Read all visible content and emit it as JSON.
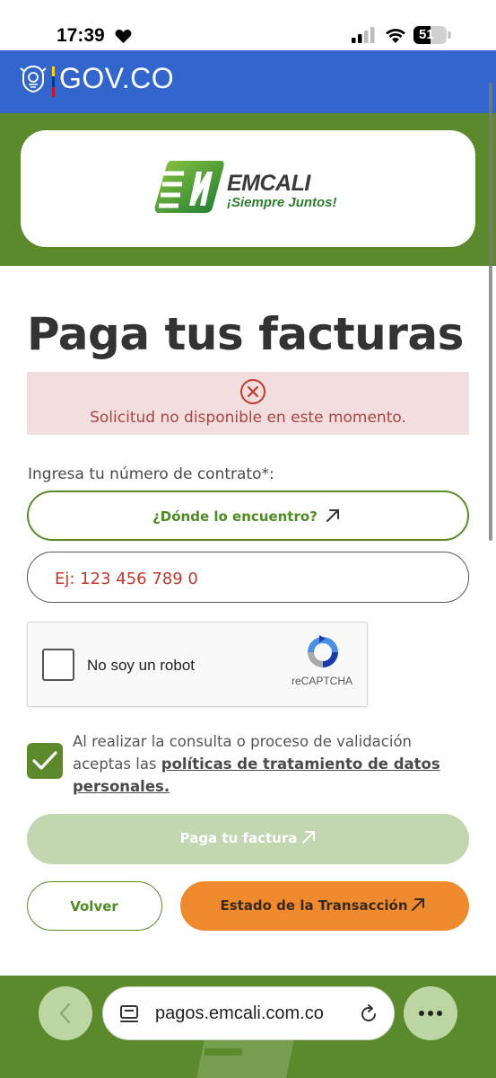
{
  "status_bar": {
    "time": "17:39",
    "battery": "51",
    "icons": [
      "heart-icon",
      "signal-icon",
      "wifi-icon",
      "battery-icon"
    ]
  },
  "gov_bar": {
    "title": "GOV.CO",
    "color": "#3366cc"
  },
  "brand": {
    "name": "EMCALI",
    "slogan": "¡Siempre Juntos!",
    "accent_color": "#5a8a2b"
  },
  "page": {
    "title": "Paga tus facturas"
  },
  "error": {
    "message": "Solicitud no disponible en este momento.",
    "icon": "error-circle-x-icon"
  },
  "form": {
    "contract_label": "Ingresa tu número de contrato*:",
    "where_button_label": "¿Dónde lo encuentro?",
    "contract_placeholder": "Ej: 123 456 789 0",
    "recaptcha_label": "No soy un robot",
    "recaptcha_brand": "reCAPTCHA",
    "recaptcha_checked": false,
    "consent_text": "Al realizar la consulta o proceso de validación aceptas las",
    "consent_link": "políticas de tratamiento de datos personales.",
    "consent_checked": true
  },
  "actions": {
    "pay_label": "Paga tu factura",
    "back_label": "Volver",
    "status_label": "Estado de la Transacción"
  },
  "browser": {
    "url": "pagos.emcali.com.co"
  }
}
